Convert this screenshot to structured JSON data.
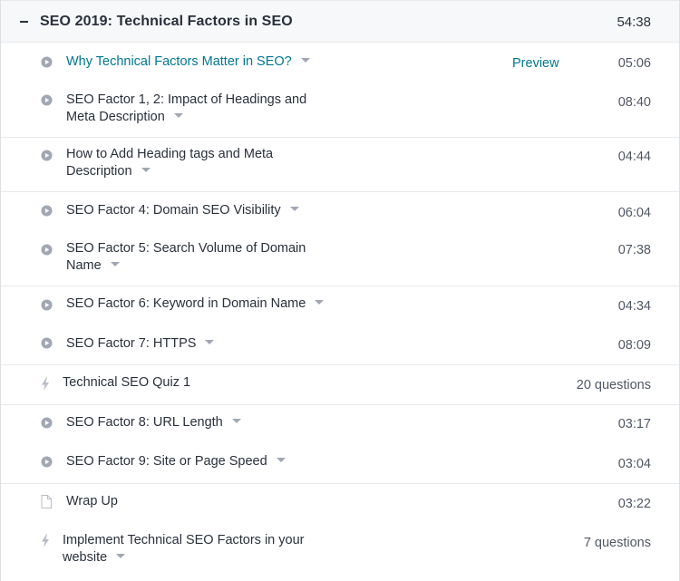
{
  "section": {
    "title": "SEO 2019: Technical Factors in SEO",
    "duration": "54:38",
    "collapse_icon": "minus-icon"
  },
  "colors": {
    "link": "#007791",
    "text": "#29303b",
    "icon": "#a1a7b3",
    "header_bg": "#f7f8fa"
  },
  "lectures": [
    {
      "type": "video",
      "icon": "play-circle-icon",
      "title": "Why Technical Factors Matter in SEO?",
      "preview": "Preview",
      "duration": "05:06"
    },
    {
      "type": "video",
      "icon": "play-circle-icon",
      "title": "SEO Factor 1, 2: Impact of Headings and Meta Description",
      "duration": "08:40"
    },
    {
      "type": "video",
      "icon": "play-circle-icon",
      "title": "How to Add Heading tags and Meta Description",
      "duration": "04:44"
    },
    {
      "type": "video",
      "icon": "play-circle-icon",
      "title": "SEO Factor 4: Domain SEO Visibility",
      "duration": "06:04"
    },
    {
      "type": "video",
      "icon": "play-circle-icon",
      "title": "SEO Factor 5: Search Volume of Domain Name",
      "duration": "07:38"
    },
    {
      "type": "video",
      "icon": "play-circle-icon",
      "title": "SEO Factor 6: Keyword in Domain Name",
      "duration": "04:34"
    },
    {
      "type": "video",
      "icon": "play-circle-icon",
      "title": "SEO Factor 7: HTTPS",
      "duration": "08:09"
    },
    {
      "type": "quiz",
      "icon": "lightning-bolt-icon",
      "title": "Technical SEO Quiz 1",
      "duration": "20 questions"
    },
    {
      "type": "video",
      "icon": "play-circle-icon",
      "title": "SEO Factor 8: URL Length",
      "duration": "03:17"
    },
    {
      "type": "video",
      "icon": "play-circle-icon",
      "title": "SEO Factor 9: Site or Page Speed",
      "duration": "03:04"
    },
    {
      "type": "article",
      "icon": "file-icon",
      "title": "Wrap Up",
      "duration": "03:22"
    },
    {
      "type": "quiz",
      "icon": "lightning-bolt-icon",
      "title": "Implement Technical SEO Factors in your website",
      "duration": "7 questions"
    }
  ]
}
